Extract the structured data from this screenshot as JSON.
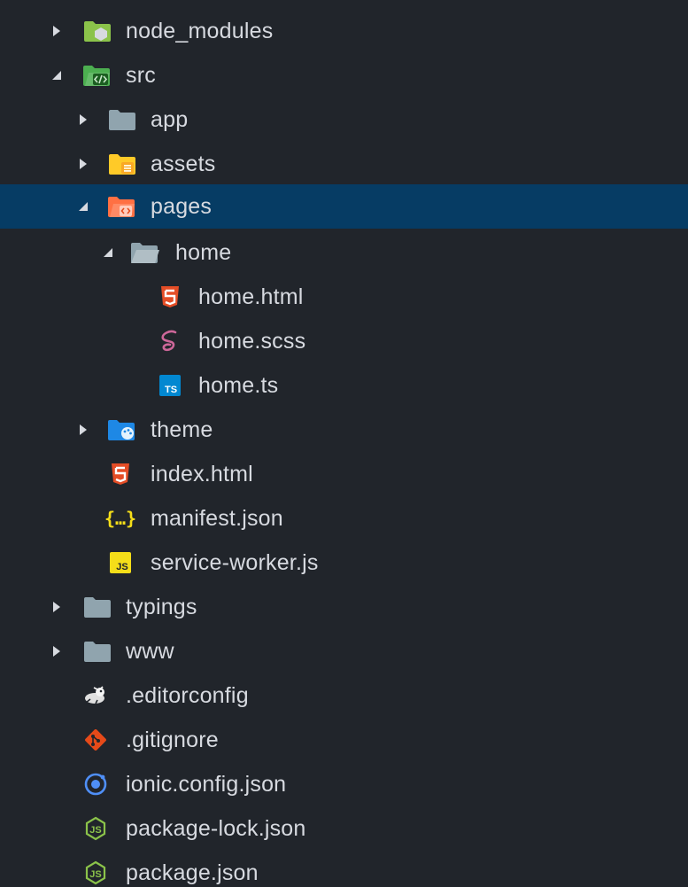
{
  "explorer": {
    "items": [
      {
        "label": "node_modules",
        "icon": "folder-node-icon",
        "kind": "folder",
        "expanded": false
      },
      {
        "label": "src",
        "icon": "folder-src-icon",
        "kind": "folder",
        "expanded": true
      },
      {
        "label": "app",
        "icon": "folder-icon",
        "kind": "folder",
        "expanded": false
      },
      {
        "label": "assets",
        "icon": "folder-assets-icon",
        "kind": "folder",
        "expanded": false
      },
      {
        "label": "pages",
        "icon": "folder-pages-icon",
        "kind": "folder",
        "expanded": true,
        "selected": true
      },
      {
        "label": "home",
        "icon": "folder-open-icon",
        "kind": "folder",
        "expanded": true
      },
      {
        "label": "home.html",
        "icon": "html5-icon",
        "kind": "file"
      },
      {
        "label": "home.scss",
        "icon": "sass-icon",
        "kind": "file"
      },
      {
        "label": "home.ts",
        "icon": "typescript-icon",
        "kind": "file"
      },
      {
        "label": "theme",
        "icon": "folder-theme-icon",
        "kind": "folder",
        "expanded": false
      },
      {
        "label": "index.html",
        "icon": "html5-icon",
        "kind": "file"
      },
      {
        "label": "manifest.json",
        "icon": "json-braces-icon",
        "kind": "file"
      },
      {
        "label": "service-worker.js",
        "icon": "javascript-icon",
        "kind": "file"
      },
      {
        "label": "typings",
        "icon": "folder-icon",
        "kind": "folder",
        "expanded": false
      },
      {
        "label": "www",
        "icon": "folder-icon",
        "kind": "folder",
        "expanded": false
      },
      {
        "label": ".editorconfig",
        "icon": "editorconfig-icon",
        "kind": "file"
      },
      {
        "label": ".gitignore",
        "icon": "git-icon",
        "kind": "file"
      },
      {
        "label": "ionic.config.json",
        "icon": "ionic-icon",
        "kind": "file"
      },
      {
        "label": "package-lock.json",
        "icon": "nodejs-icon",
        "kind": "file"
      },
      {
        "label": "package.json",
        "icon": "nodejs-icon",
        "kind": "file"
      }
    ]
  },
  "colors": {
    "background": "#21252b",
    "selection": "#063c64",
    "text": "#d7dae0",
    "html": "#e44d26",
    "sass": "#cd6799",
    "typescript": "#0288d1",
    "javascript": "#f5de19",
    "node": "#8bc34a",
    "git": "#e64a19",
    "ionic": "#4f8ff7"
  }
}
